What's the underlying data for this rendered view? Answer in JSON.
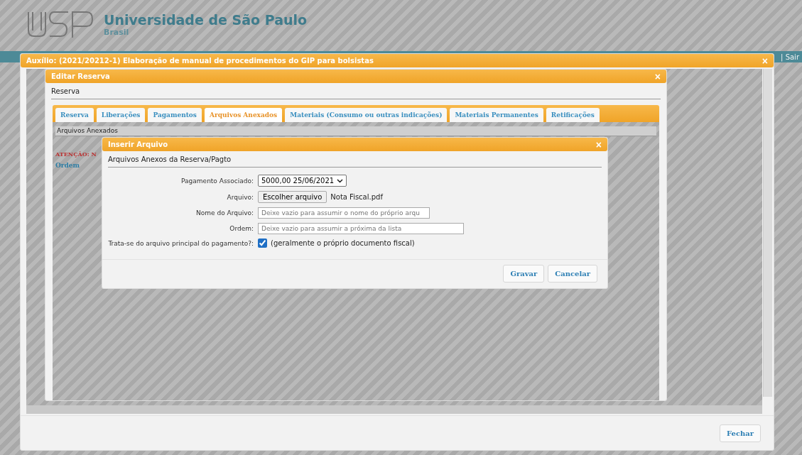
{
  "site": {
    "title": "Universidade de São Paulo",
    "subtitle": "Brasil",
    "logout": "| Sair"
  },
  "outer_dialog": {
    "title": "Auxílio: (2021/20212-1) Elaboração de manual de procedimentos do GIP para bolsistas",
    "close": "×",
    "footer_button": "Fechar"
  },
  "edit_dialog": {
    "title": "Editar Reserva",
    "close": "×",
    "section": "Reserva",
    "panel_heading": "Arquivos Anexados",
    "warning": "ATENÇÃO: N",
    "column_1": "Ordem",
    "tabs": [
      {
        "label": "Reserva",
        "selected": false
      },
      {
        "label": "Liberações",
        "selected": false
      },
      {
        "label": "Pagamentos",
        "selected": false
      },
      {
        "label": "Arquivos Anexados",
        "selected": true
      },
      {
        "label": "Materiais (Consumo ou outras indicações)",
        "selected": false
      },
      {
        "label": "Materiais Permanentes",
        "selected": false
      },
      {
        "label": "Retificações",
        "selected": false
      }
    ]
  },
  "insert_dialog": {
    "title": "Inserir Arquivo",
    "close": "×",
    "section": "Arquivos Anexos da Reserva/Pagto",
    "fields": [
      {
        "kind": "select",
        "label": "Pagamento Associado:",
        "value": "5000,00 25/06/2021"
      },
      {
        "kind": "file",
        "label": "Arquivo:",
        "button": "Escolher arquivo",
        "value": "Nota Fiscal.pdf"
      },
      {
        "kind": "text",
        "label": "Nome do Arquivo:",
        "placeholder": "Deixe vazio para assumir o nome do próprio arqu"
      },
      {
        "kind": "text",
        "label": "Ordem:",
        "placeholder": "Deixe vazio para assumir a próxima da lista"
      },
      {
        "kind": "checkbox",
        "label": "Trata-se do arquivo principal do pagamento?:",
        "checked": true,
        "note": "(geralmente o próprio documento fiscal)"
      }
    ],
    "buttons": [
      "Gravar",
      "Cancelar"
    ]
  }
}
